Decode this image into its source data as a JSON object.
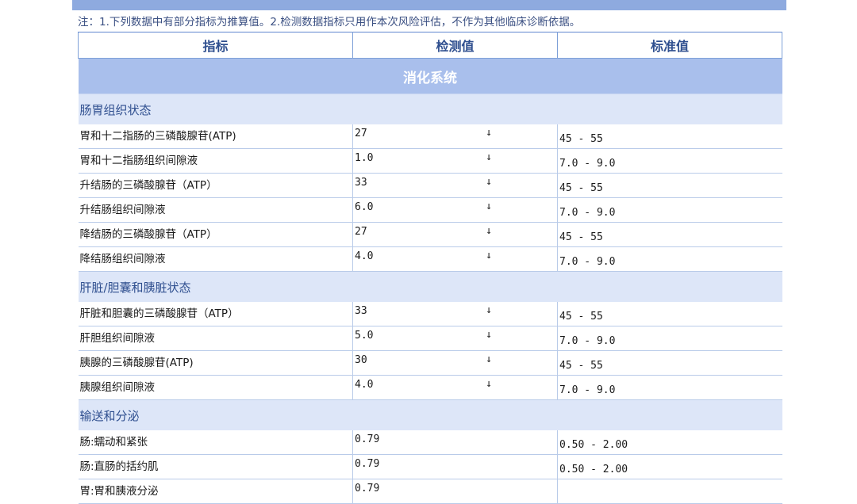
{
  "note": "注：1.下列数据中有部分指标为推算值。2.检测数据指标只用作本次风险评估，不作为其他临床诊断依据。",
  "headers": {
    "indicator": "指标",
    "measured": "检测值",
    "standard": "标准值"
  },
  "system_title": "消化系统",
  "sections": [
    {
      "title": "肠胃组织状态",
      "rows": [
        {
          "name": "胃和十二指肠的三磷酸腺苷(ATP)",
          "value": "27",
          "arrow": "↓",
          "standard": "45 - 55"
        },
        {
          "name": "胃和十二指肠组织间隙液",
          "value": "1.0",
          "arrow": "↓",
          "standard": "7.0 - 9.0"
        },
        {
          "name": "升结肠的三磷酸腺苷（ATP）",
          "value": "33",
          "arrow": "↓",
          "standard": "45 - 55"
        },
        {
          "name": "升结肠组织间隙液",
          "value": "6.0",
          "arrow": "↓",
          "standard": "7.0 - 9.0"
        },
        {
          "name": "降结肠的三磷酸腺苷（ATP）",
          "value": "27",
          "arrow": "↓",
          "standard": "45 - 55"
        },
        {
          "name": "降结肠组织间隙液",
          "value": "4.0",
          "arrow": "↓",
          "standard": "7.0 - 9.0"
        }
      ]
    },
    {
      "title": "肝脏/胆囊和胰脏状态",
      "rows": [
        {
          "name": "肝脏和胆囊的三磷酸腺苷（ATP）",
          "value": "33",
          "arrow": "↓",
          "standard": "45 - 55"
        },
        {
          "name": "肝胆组织间隙液",
          "value": "5.0",
          "arrow": "↓",
          "standard": "7.0 - 9.0"
        },
        {
          "name": "胰腺的三磷酸腺苷(ATP)",
          "value": "30",
          "arrow": "↓",
          "standard": "45 - 55"
        },
        {
          "name": "胰腺组织间隙液",
          "value": "4.0",
          "arrow": "↓",
          "standard": "7.0 - 9.0"
        }
      ]
    },
    {
      "title": "输送和分泌",
      "rows": [
        {
          "name": "肠:蠕动和紧张",
          "value": "0.79",
          "arrow": "",
          "standard": "0.50 - 2.00"
        },
        {
          "name": "肠:直肠的括约肌",
          "value": "0.79",
          "arrow": "",
          "standard": "0.50 - 2.00"
        },
        {
          "name": "胃:胃和胰液分泌",
          "value": "0.79",
          "arrow": "",
          "standard": ""
        }
      ]
    }
  ]
}
